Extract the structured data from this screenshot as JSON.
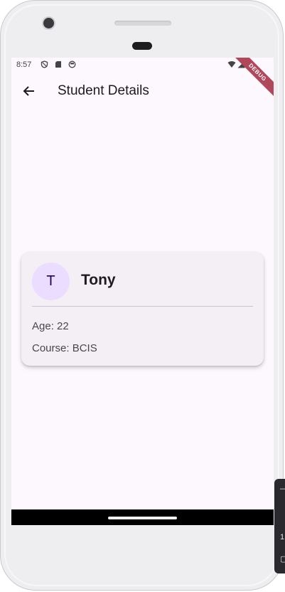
{
  "status_bar": {
    "time": "8:57",
    "debug_label": "DEBUG"
  },
  "app_bar": {
    "title": "Student Details"
  },
  "student": {
    "initial": "T",
    "name": "Tony",
    "age_text": "Age: 22",
    "course_text": "Course: BCIS"
  },
  "side_panel": {
    "glyph": "1"
  },
  "colors": {
    "background": "#fdf7fe",
    "card": "#f4eff5",
    "avatar_bg": "#eaddff",
    "avatar_text": "#21005d",
    "debug_ribbon": "#b0475a"
  }
}
